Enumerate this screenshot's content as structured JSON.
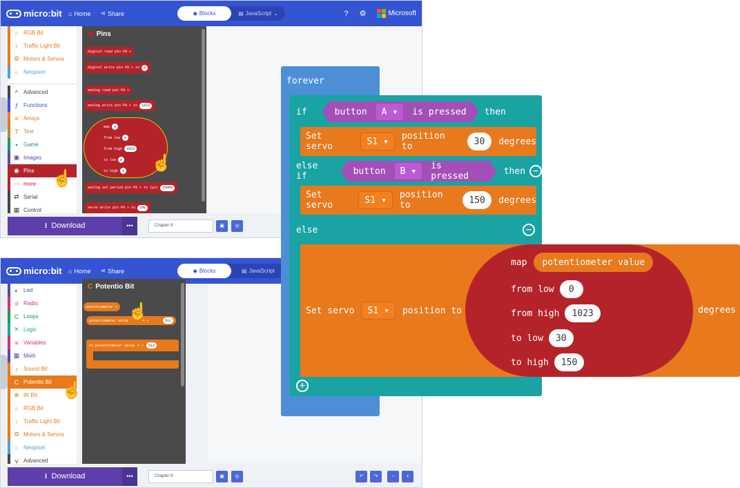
{
  "header": {
    "brand": "micro:bit",
    "home": "Home",
    "share": "Share",
    "tab_blocks": "Blocks",
    "tab_js": "JavaScript",
    "microsoft": "Microsoft"
  },
  "top_toolbox": [
    {
      "label": "RGB Bit",
      "color": "#e8791d",
      "icon": "○"
    },
    {
      "label": "Traffic Light Bit",
      "color": "#e8791d",
      "icon": "♀"
    },
    {
      "label": "Motors & Servos",
      "color": "#e8791d",
      "icon": "⚙"
    },
    {
      "label": "Neopixel",
      "color": "#4aa3df",
      "icon": "○"
    },
    {
      "label": "Advanced",
      "color": "#444",
      "icon": "^"
    },
    {
      "label": "Functions",
      "color": "#3454d1",
      "icon": "ƒ"
    },
    {
      "label": "Arrays",
      "color": "#e8791d",
      "icon": "≡"
    },
    {
      "label": "Text",
      "color": "#b88a30",
      "icon": "T"
    },
    {
      "label": "Game",
      "color": "#1a9a5a",
      "icon": "▪"
    },
    {
      "label": "Images",
      "color": "#5a4aa8",
      "icon": "▣"
    },
    {
      "label": "Pins",
      "color": "#b5232a",
      "icon": "◉"
    },
    {
      "label": "more",
      "color": "#b5232a",
      "icon": "⋯"
    },
    {
      "label": "Serial",
      "color": "#444",
      "icon": "⇄"
    },
    {
      "label": "Control",
      "color": "#444",
      "icon": "▦"
    }
  ],
  "top_flyout": {
    "title": "Pins",
    "blocks": {
      "digital_read": "digital read pin",
      "digital_write": "digital write pin",
      "analog_read": "analog read pin",
      "analog_write": "analog write pin",
      "map": "map",
      "from_low": "from low",
      "from_high": "from high",
      "to_low": "to low",
      "to_high": "to high",
      "analog_period": "analog set period pin",
      "servo_write": "servo write pin",
      "pin": "P0 ▾",
      "to": "to",
      "to_us": "to (µs)",
      "v0": "0",
      "v1023": "1023",
      "v4": "4",
      "v20000": "20000",
      "v180": "180"
    }
  },
  "bottom_toolbox": [
    {
      "label": "Led",
      "color": "#5a4aa8",
      "icon": "◐"
    },
    {
      "label": "Radio",
      "color": "#d4326f",
      "icon": "ıl"
    },
    {
      "label": "Loops",
      "color": "#1a9a5a",
      "icon": "C"
    },
    {
      "label": "Logic",
      "color": "#1aa3a3",
      "icon": "✕"
    },
    {
      "label": "Variables",
      "color": "#d4326f",
      "icon": "≡"
    },
    {
      "label": "Math",
      "color": "#5a4aa8",
      "icon": "▦"
    },
    {
      "label": "Sound Bit",
      "color": "#e8791d",
      "icon": "♪"
    },
    {
      "label": "Potentio Bit",
      "color": "#e8791d",
      "icon": "C"
    },
    {
      "label": "IR Bit",
      "color": "#e8791d",
      "icon": "⊕"
    },
    {
      "label": "RGB Bit",
      "color": "#e8791d",
      "icon": "○"
    },
    {
      "label": "Traffic Light Bit",
      "color": "#e8791d",
      "icon": "♀"
    },
    {
      "label": "Motors & Servos",
      "color": "#e8791d",
      "icon": "⚙"
    },
    {
      "label": "Neopixel",
      "color": "#4aa3df",
      "icon": "○"
    },
    {
      "label": "Advanced",
      "color": "#444",
      "icon": "v"
    }
  ],
  "bottom_flyout": {
    "title": "Potentio Bit",
    "potvalue": "potentiometer value",
    "potvalue2": "potentiometer v",
    "cmp": "= ▾",
    "v512": "512",
    "on_block": "on potentiometer value",
    "on_eq": "= ▾"
  },
  "footer": {
    "download": "Download",
    "more": "•••",
    "project_name": "Chapter 9"
  },
  "program": {
    "forever": "forever",
    "if": "if",
    "button": "button",
    "btn_a": "A",
    "btn_b": "B",
    "is_pressed": "is pressed",
    "then": "then",
    "else_if": "else if",
    "else": "else",
    "set_servo": "Set servo",
    "servo_s1": "S1",
    "position_to": "position to",
    "degrees": "degrees",
    "pos1": "30",
    "pos2": "150",
    "map": "map",
    "pot_value": "potentiometer value",
    "from_low": "from low",
    "from_high": "from high",
    "to_low": "to low",
    "to_high": "to high",
    "map_from_low": "0",
    "map_from_high": "1023",
    "map_to_low": "30",
    "map_to_high": "150"
  }
}
